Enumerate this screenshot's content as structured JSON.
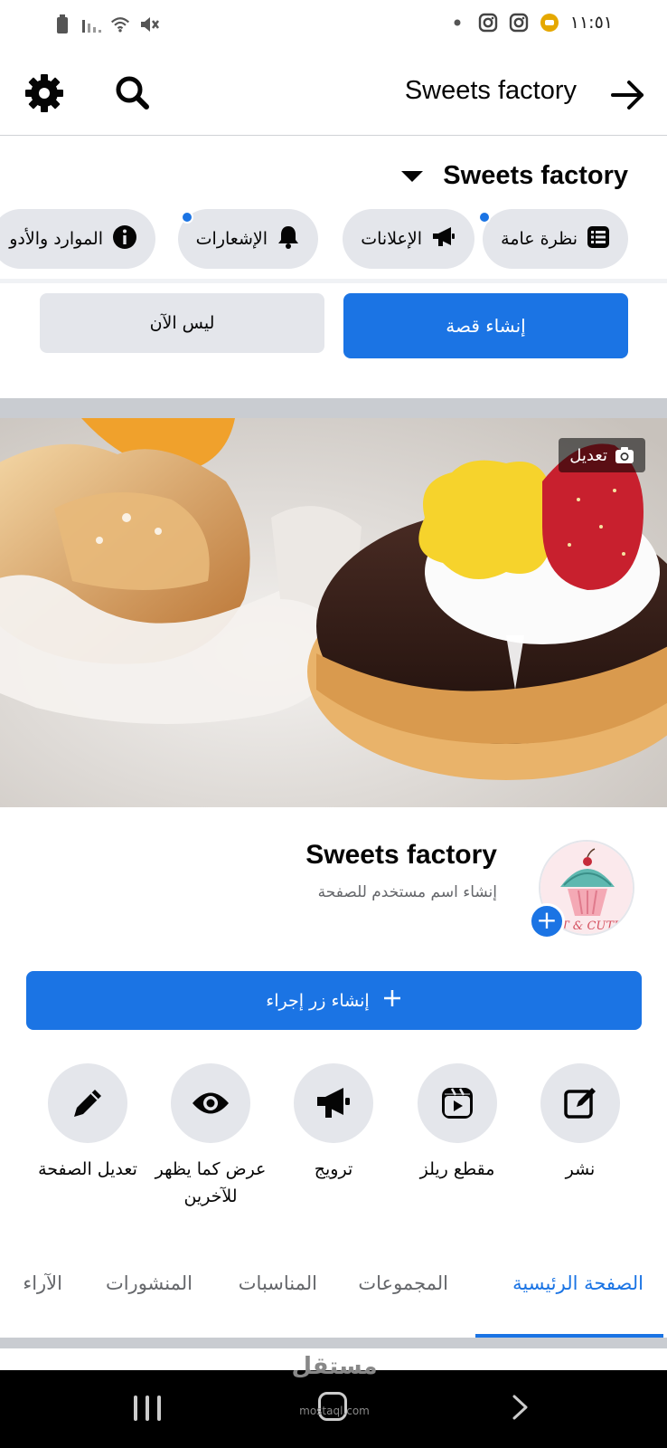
{
  "status_bar": {
    "time": "١١:٥١",
    "icons": [
      "battery-icon",
      "signal-icon",
      "wifi-icon",
      "mute-icon",
      "dot-icon",
      "instagram-icon",
      "instagram-icon",
      "app-icon"
    ]
  },
  "header": {
    "title": "Sweets factory",
    "icons": [
      "gear-icon",
      "search-icon",
      "arrow-right-icon"
    ]
  },
  "page_switcher": {
    "name": "Sweets factory"
  },
  "chips": [
    {
      "label": "نظرة عامة",
      "icon": "list-icon",
      "has_dot": true
    },
    {
      "label": "الإعلانات",
      "icon": "megaphone-icon",
      "has_dot": false
    },
    {
      "label": "الإشعارات",
      "icon": "bell-icon",
      "has_dot": true
    },
    {
      "label": "الموارد والأدو",
      "icon": "info-icon",
      "has_dot": false
    }
  ],
  "story": {
    "create_label": "إنشاء قصة",
    "not_now_label": "ليس الآن"
  },
  "cover": {
    "edit_label": "تعديل"
  },
  "profile": {
    "name": "Sweets factory",
    "subtitle": "إنشاء اسم مستخدم للصفحة",
    "avatar_text": "ET & CUTE"
  },
  "action_button": {
    "label": "إنشاء زر إجراء"
  },
  "quick_actions": [
    {
      "label": "نشر",
      "icon": "compose-icon"
    },
    {
      "label": "مقطع ريلز",
      "icon": "reels-icon"
    },
    {
      "label": "ترويج",
      "icon": "megaphone-icon"
    },
    {
      "label_line1": "عرض كما يظهر",
      "label_line2": "للآخرين",
      "icon": "eye-icon"
    },
    {
      "label": "تعديل الصفحة",
      "icon": "pencil-icon"
    }
  ],
  "tabs": [
    "الصفحة الرئيسية",
    "المجموعات",
    "المناسبات",
    "المنشورات",
    "الآراء"
  ],
  "active_tab": "الصفحة الرئيسية",
  "watermark": {
    "text": "مستقل",
    "sub": "mostaql.com"
  },
  "colors": {
    "accent": "#1b74e4",
    "chip_bg": "#e4e6eb",
    "text": "#050505",
    "muted": "#65676b"
  }
}
